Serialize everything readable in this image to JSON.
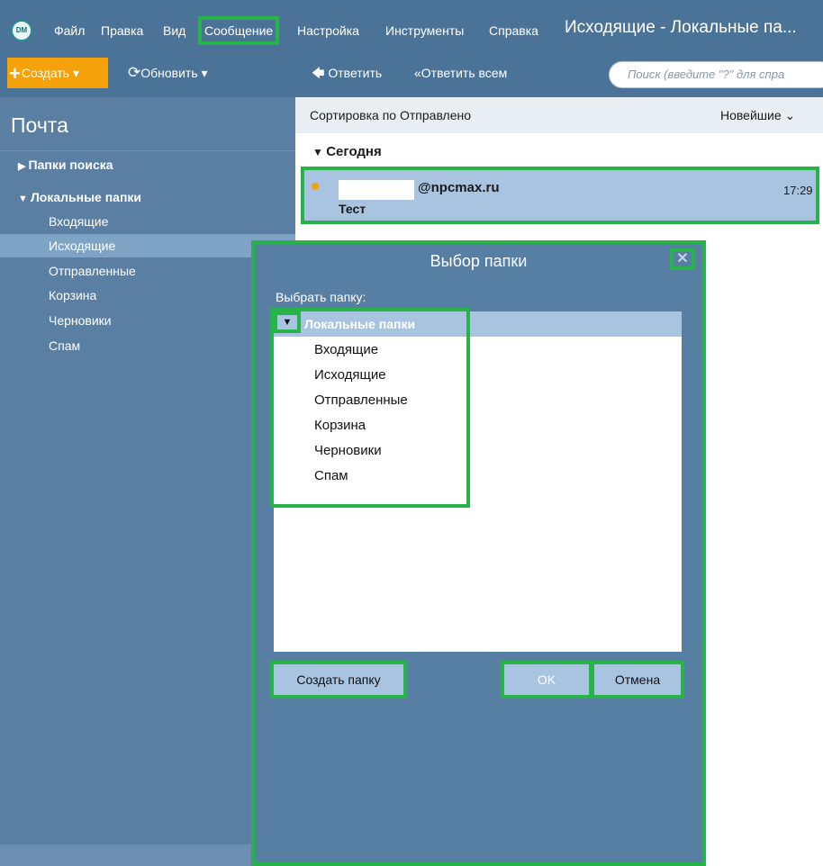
{
  "menubar": {
    "logo_text": "DM",
    "items": [
      "Файл",
      "Правка",
      "Вид",
      "Сообщение",
      "Настройка",
      "Инструменты",
      "Справка"
    ],
    "window_title": "Исходящие - Локальные па..."
  },
  "toolbar": {
    "create_label": "Создать",
    "refresh_label": "Обновить",
    "reply_label": "Ответить",
    "reply_all_label": "Ответить всем",
    "search_placeholder": "Поиск (введите \"?\" для спра"
  },
  "sidebar": {
    "title": "Почта",
    "search_folders": "Папки поиска",
    "local_folders": "Локальные папки",
    "items": [
      "Входящие",
      "Исходящие",
      "Отправленные",
      "Корзина",
      "Черновики",
      "Спам"
    ],
    "selected": "Исходящие"
  },
  "message_list": {
    "sort_label": "Сортировка по Отправлено",
    "sort_order": "Новейшие",
    "group_label": "Сегодня",
    "messages": [
      {
        "from": "@npcmax.ru",
        "subject": "Тест",
        "time": "17:29",
        "unread": true
      }
    ]
  },
  "dialog": {
    "title": "Выбор папки",
    "label": "Выбрать папку:",
    "tree_root": "Локальные папки",
    "tree_items": [
      "Входящие",
      "Исходящие",
      "Отправленные",
      "Корзина",
      "Черновики",
      "Спам"
    ],
    "create_folder_label": "Создать папку",
    "ok_label": "OK",
    "cancel_label": "Отмена"
  },
  "colors": {
    "chrome": "#4a7397",
    "sidebar": "#5a7fa2",
    "accent_orange": "#f5a20a",
    "selection": "#a8c4e0",
    "highlight_box": "#27b24a"
  }
}
